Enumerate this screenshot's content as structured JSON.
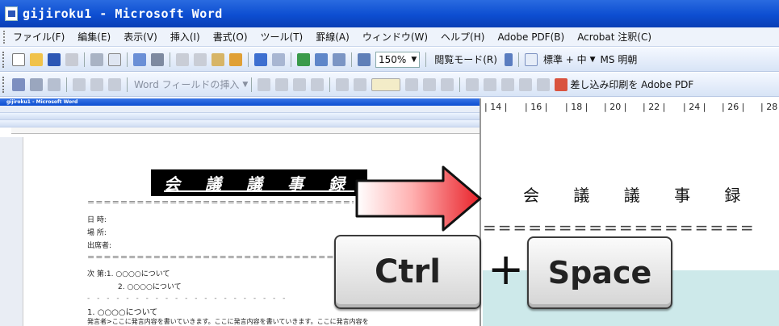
{
  "window": {
    "title": "gijiroku1 - Microsoft Word"
  },
  "menu": [
    "ファイル(F)",
    "編集(E)",
    "表示(V)",
    "挿入(I)",
    "書式(O)",
    "ツール(T)",
    "罫線(A)",
    "ウィンドウ(W)",
    "ヘルプ(H)",
    "Adobe PDF(B)",
    "Acrobat 注釈(C)"
  ],
  "toolbar1": {
    "zoom": "150%",
    "reading_mode": "閲覧モード(R)",
    "style": "標準 + 中",
    "font": "MS 明朝"
  },
  "toolbar2": {
    "insert_field": "Word フィールドの挿入",
    "mail_merge": "差し込み印刷を Adobe PDF"
  },
  "thumbnail": {
    "title": "gijiroku1 - Microsoft Word",
    "heading": "会 議 議 事 録",
    "fields": [
      "日 時:",
      "場 所:",
      "出席者:"
    ],
    "agenda": [
      "次 第:1. ○○○○について",
      "2. ○○○○について"
    ],
    "section": "1. ○○○○について",
    "body": "発言者>ここに発言内容を書いていきます。ここに発言内容を書いていきます。ここに発言内容を"
  },
  "zoomed": {
    "ruler": [
      "14",
      "16",
      "18",
      "20",
      "22",
      "24",
      "26",
      "28"
    ],
    "heading": "会 議 議 事 録"
  },
  "keys": {
    "ctrl": "Ctrl",
    "plus": "+",
    "space": "Space"
  },
  "colors": {
    "title_bar": "#0d4ed1",
    "arrow_red": "#e8222a",
    "teal": "#cde9ea"
  }
}
